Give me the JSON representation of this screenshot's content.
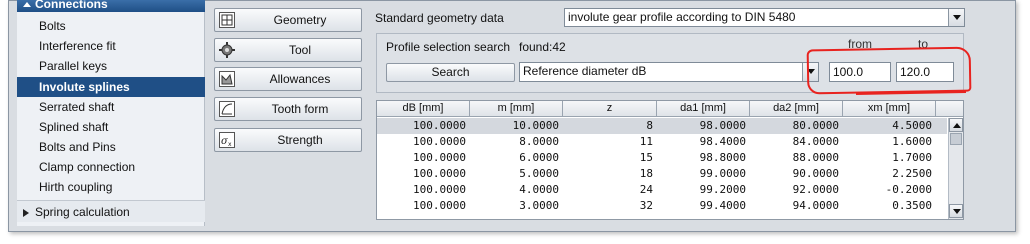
{
  "sidebar": {
    "header": "Connections",
    "items": [
      {
        "label": "Bolts",
        "active": false
      },
      {
        "label": "Interference fit",
        "active": false
      },
      {
        "label": "Parallel keys",
        "active": false
      },
      {
        "label": "Involute splines",
        "active": true
      },
      {
        "label": "Serrated shaft",
        "active": false
      },
      {
        "label": "Splined shaft",
        "active": false
      },
      {
        "label": "Bolts and Pins",
        "active": false
      },
      {
        "label": "Clamp connection",
        "active": false
      },
      {
        "label": "Hirth coupling",
        "active": false
      }
    ],
    "spring_calc": "Spring calculation"
  },
  "tools": [
    {
      "label": "Geometry",
      "icon": "geometry-icon"
    },
    {
      "label": "Tool",
      "icon": "tool-gear-icon"
    },
    {
      "label": "Allowances",
      "icon": "allowances-icon"
    },
    {
      "label": "Tooth form",
      "icon": "tooth-form-icon"
    },
    {
      "label": "Strength",
      "icon": "strength-icon"
    }
  ],
  "geometry": {
    "label": "Standard geometry data",
    "value": "involute gear profile according to DIN 5480"
  },
  "search": {
    "label": "Profile selection search",
    "found": "found:42",
    "button": "Search",
    "parameter": "Reference diameter dB",
    "from_label": "from",
    "to_label": "to",
    "from_value": "100.0",
    "to_value": "120.0"
  },
  "table": {
    "columns": [
      "dB [mm]",
      "m [mm]",
      "z",
      "da1 [mm]",
      "da2 [mm]",
      "xm [mm]"
    ],
    "rows": [
      [
        "100.0000",
        "10.0000",
        "8",
        "98.0000",
        "80.0000",
        "4.5000"
      ],
      [
        "100.0000",
        "8.0000",
        "11",
        "98.4000",
        "84.0000",
        "1.6000"
      ],
      [
        "100.0000",
        "6.0000",
        "15",
        "98.8000",
        "88.0000",
        "1.7000"
      ],
      [
        "100.0000",
        "5.0000",
        "18",
        "99.0000",
        "90.0000",
        "2.2500"
      ],
      [
        "100.0000",
        "4.0000",
        "24",
        "99.2000",
        "92.0000",
        "-0.2000"
      ],
      [
        "100.0000",
        "3.0000",
        "32",
        "99.4000",
        "94.0000",
        "0.3500"
      ]
    ],
    "selected_row": 0
  },
  "colors": {
    "accent": "#1f4f86",
    "annotation": "#e8231f"
  }
}
